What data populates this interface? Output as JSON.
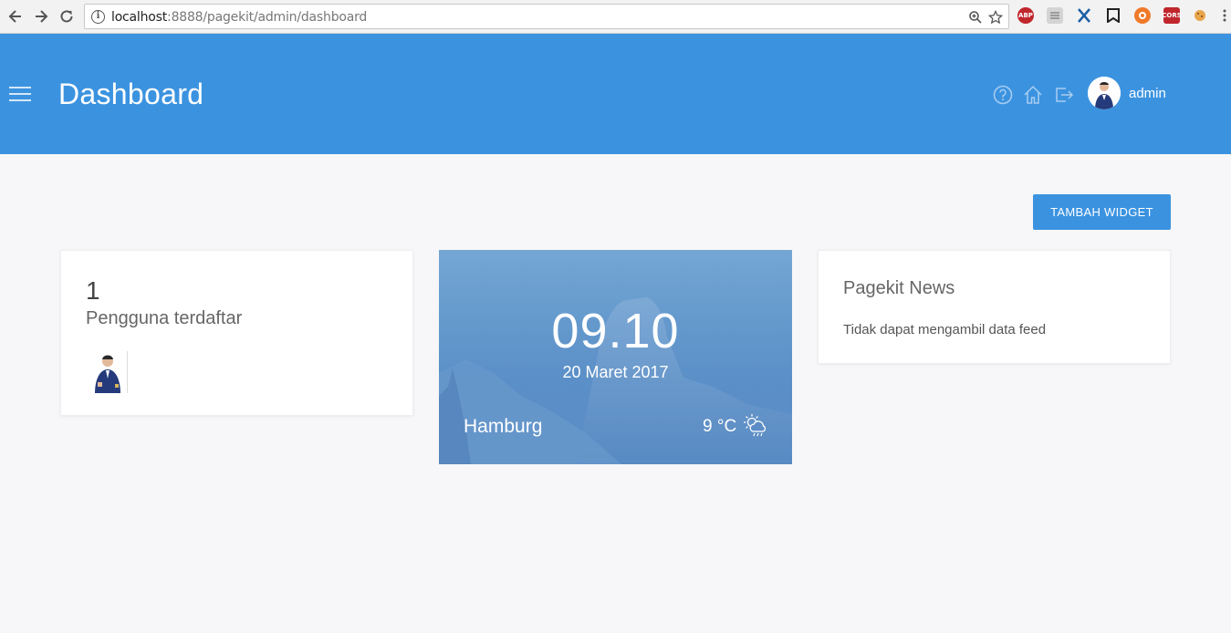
{
  "browser": {
    "url_host": "localhost",
    "url_path": ":8888/pagekit/admin/dashboard",
    "extensions": [
      "abp-icon",
      "reader-icon",
      "x-icon",
      "bookmark-icon",
      "lifebuoy-icon",
      "cors-icon",
      "cookie-icon"
    ],
    "ext_labels": {
      "abp": "ABP",
      "cors": "CORS"
    }
  },
  "header": {
    "title": "Dashboard",
    "username": "admin",
    "icons": [
      "help-icon",
      "home-icon",
      "logout-icon"
    ]
  },
  "toolbar": {
    "add_widget_label": "TAMBAH WIDGET"
  },
  "users_widget": {
    "count": "1",
    "label": "Pengguna terdaftar"
  },
  "weather_widget": {
    "time": "09.10",
    "date": "20 Maret 2017",
    "city": "Hamburg",
    "temperature": "9 °C",
    "condition_icon": "partly-cloudy-rain-icon"
  },
  "news_widget": {
    "title": "Pagekit News",
    "message": "Tidak dapat mengambil data feed"
  },
  "colors": {
    "accent": "#3b93e0",
    "background": "#f7f7f9"
  }
}
